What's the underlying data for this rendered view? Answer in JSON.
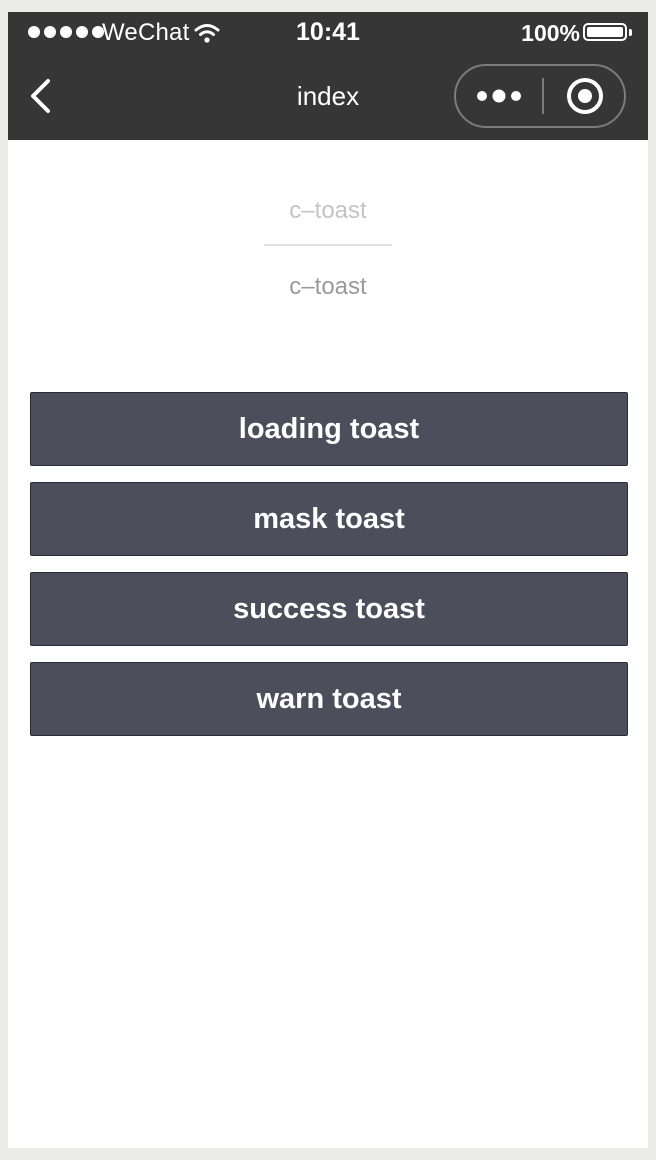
{
  "status_bar": {
    "carrier": "WeChat",
    "time": "10:41",
    "battery": "100%",
    "signal_dots": 5
  },
  "nav": {
    "title": "index"
  },
  "header": {
    "title": "c–toast",
    "desc": "c–toast"
  },
  "buttons": [
    {
      "label": "loading toast"
    },
    {
      "label": "mask toast"
    },
    {
      "label": "success toast"
    },
    {
      "label": "warn toast"
    }
  ],
  "colors": {
    "nav_bg": "#363636",
    "button_bg": "#4d4e5c",
    "page_bg": "#ffffff"
  }
}
